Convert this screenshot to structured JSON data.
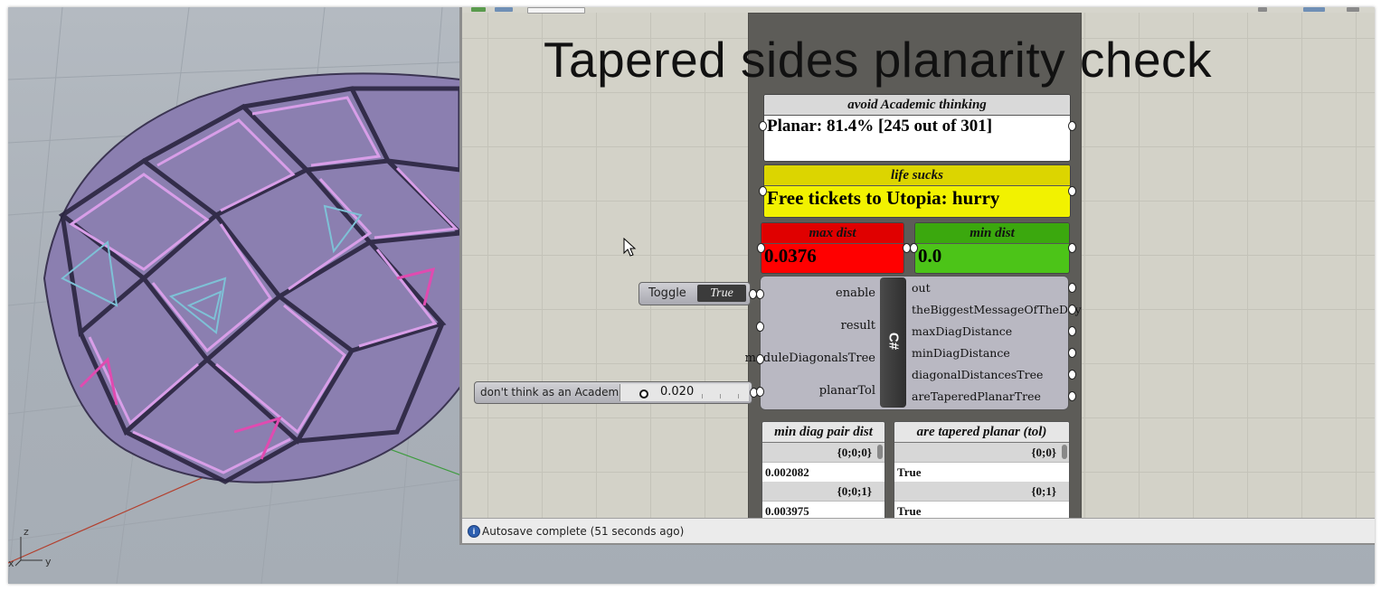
{
  "canvas": {
    "title": "Tapered sides planarity check"
  },
  "panels": {
    "avoid": {
      "header": "avoid Academic thinking",
      "value": "Planar: 81.4% [245 out of 301]"
    },
    "life": {
      "header": "life sucks",
      "value": "Free tickets to Utopia: hurry"
    },
    "max": {
      "header": "max dist",
      "value": "0.0376"
    },
    "min": {
      "header": "min dist",
      "value": "0.0"
    }
  },
  "component": {
    "label": "C#",
    "inputs": [
      "enable",
      "result",
      "moduleDiagonalsTree",
      "planarTol"
    ],
    "outputs": [
      "out",
      "theBiggestMessageOfTheDay",
      "maxDiagDistance",
      "minDiagDistance",
      "diagonalDistancesTree",
      "areTaperedPlanarTree"
    ]
  },
  "toggle": {
    "label": "Toggle",
    "value": "True"
  },
  "slider": {
    "label": "don't think as an Academic",
    "value": "0.020",
    "fraction": 0.2
  },
  "trees": {
    "minDiag": {
      "header": "min diag pair dist",
      "rows": [
        {
          "path": "{0;0;0}",
          "value": "0.002082"
        },
        {
          "path": "{0;0;1}",
          "value": "0.003975"
        }
      ]
    },
    "tapered": {
      "header": "are tapered planar (tol)",
      "rows": [
        {
          "path": "{0;0}",
          "value": "True"
        },
        {
          "path": "{0;1}",
          "value": "True"
        }
      ]
    }
  },
  "status": {
    "text": "Autosave complete (51 seconds ago)"
  },
  "viewport": {
    "axes": {
      "z": "z",
      "y": "y",
      "x": "x"
    }
  },
  "colors": {
    "group_bg": "#5d5c58",
    "panel_yellow": "#f2f200",
    "panel_red": "#ff0000",
    "panel_green": "#4cc418",
    "canvas_bg": "#d3d2c8"
  }
}
